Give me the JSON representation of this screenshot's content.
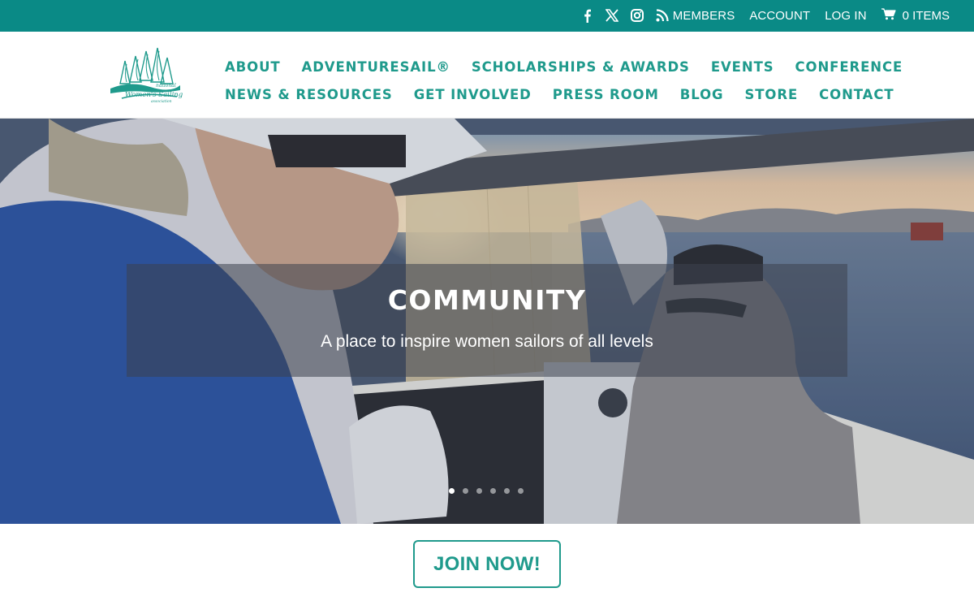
{
  "topbar": {
    "social": [
      {
        "icon": "facebook-icon"
      },
      {
        "icon": "x-icon"
      },
      {
        "icon": "instagram-icon"
      },
      {
        "icon": "rss-icon"
      }
    ],
    "links": [
      "MEMBERS",
      "ACCOUNT",
      "LOG IN"
    ],
    "cart_label": "0 ITEMS"
  },
  "logo": {
    "line1": "national",
    "line2": "Women's Sailing",
    "line3": "association"
  },
  "nav": {
    "row1": [
      "ABOUT",
      "ADVENTURESAIL®",
      "SCHOLARSHIPS & AWARDS",
      "EVENTS",
      "CONFERENCE"
    ],
    "row2": [
      "NEWS & RESOURCES",
      "GET INVOLVED",
      "PRESS ROOM",
      "BLOG",
      "STORE",
      "CONTACT"
    ]
  },
  "hero": {
    "title": "COMMUNITY",
    "subtitle": "A place to inspire women sailors of all levels",
    "slide_count": 6,
    "active_slide": 1
  },
  "cta": {
    "join_label": "JOIN NOW!"
  },
  "colors": {
    "teal": "#0a8a86",
    "nav_teal": "#1f9a8c"
  }
}
